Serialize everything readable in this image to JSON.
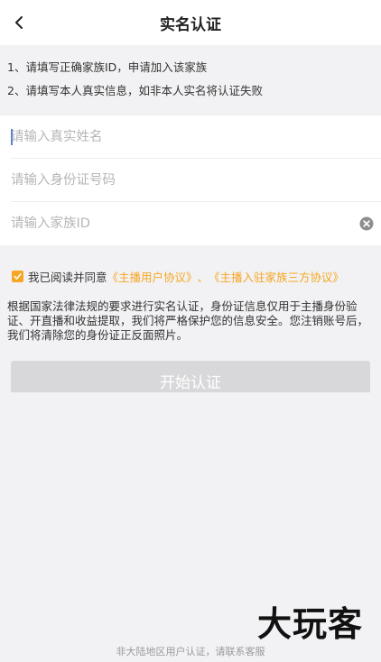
{
  "header": {
    "title": "实名认证"
  },
  "notice": {
    "line1": "1、请填写正确家族ID，申请加入该家族",
    "line2": "2、请填写本人真实信息，如非本人实名将认证失败"
  },
  "form": {
    "name_placeholder": "请输入真实姓名",
    "idcard_placeholder": "请输入身份证号码",
    "family_placeholder": "请输入家族ID"
  },
  "agreement": {
    "checked": true,
    "prefix": "我已阅读并同意",
    "link1": "《主播用户协议》",
    "separator": "、",
    "link2": "《主播入驻家族三方协议》"
  },
  "description": "根据国家法律法规的要求进行实名认证，身份证信息仅用于主播身份验证、开直播和收益提取，我们将严格保护您的信息安全。您注销账号后，我们将清除您的身份证正反面照片。",
  "start_button": "开始认证",
  "footer": "非大陆地区用户认证，请联系客服",
  "watermark": "大玩客",
  "colors": {
    "accent": "#f6a623",
    "button_disabled": "#d8d8da",
    "background": "#f2f2f4"
  }
}
